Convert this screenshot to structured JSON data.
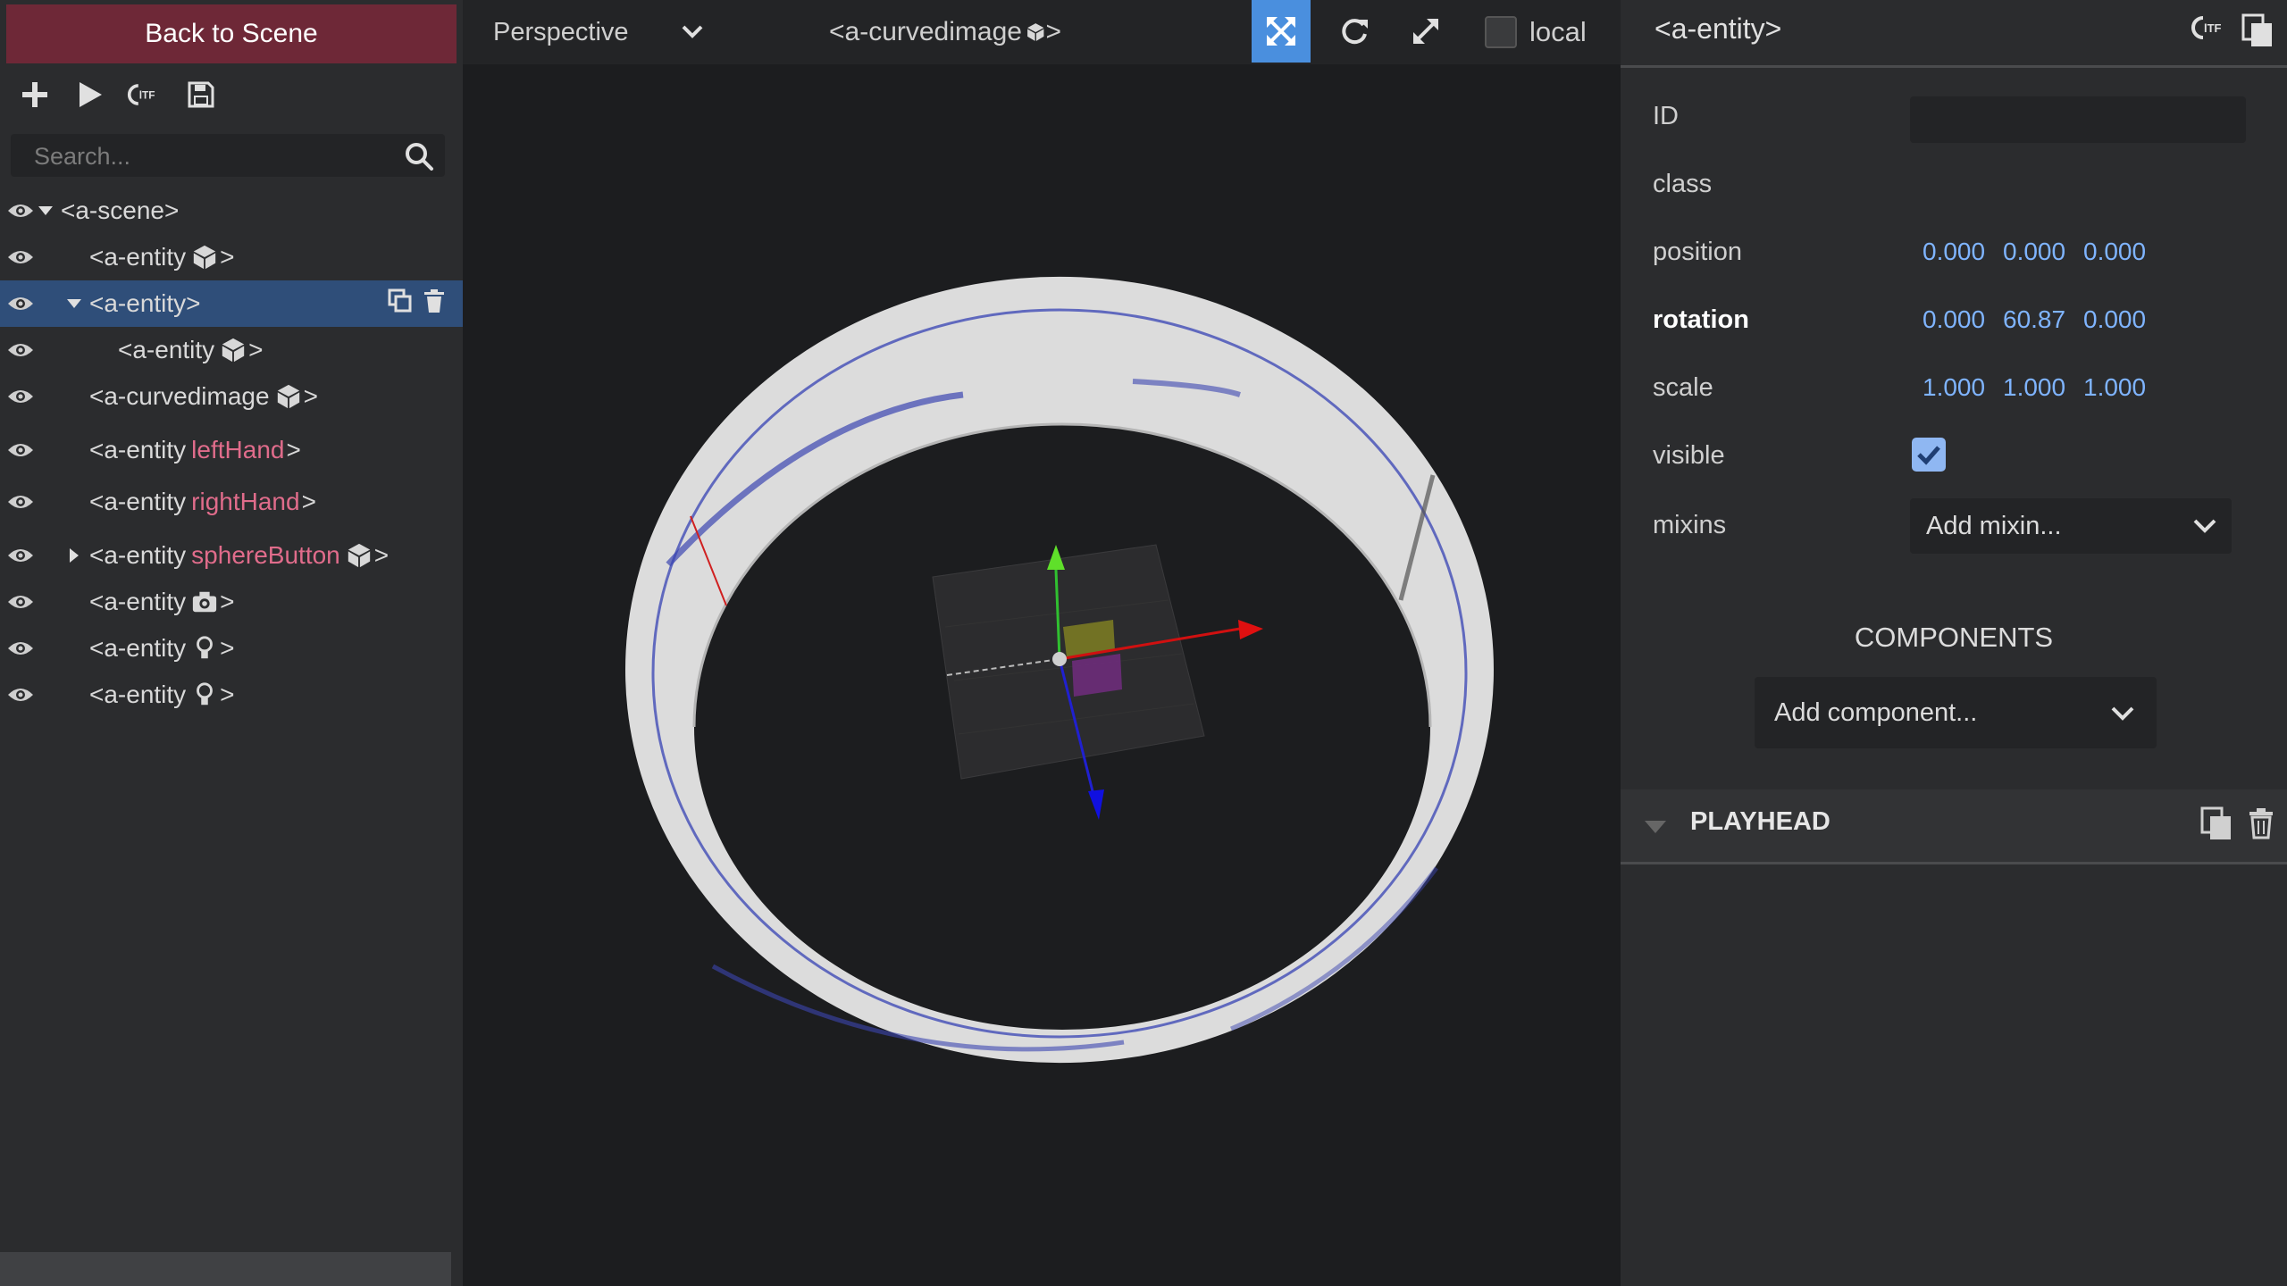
{
  "left": {
    "back_label": "Back to Scene",
    "search_placeholder": "Search...",
    "tree": [
      {
        "tag": "<a-scene>",
        "id": "",
        "suffix": ""
      },
      {
        "tag": "<a-entity",
        "id": "",
        "suffix": ">",
        "icon": "cube-icon"
      },
      {
        "tag": "<a-entity>",
        "id": "",
        "suffix": "",
        "selected": true
      },
      {
        "tag": "<a-entity",
        "id": "",
        "suffix": ">",
        "icon": "cube-icon"
      },
      {
        "tag": "<a-curvedimage",
        "id": "",
        "suffix": ">",
        "icon": "cube-icon"
      },
      {
        "tag": "<a-entity",
        "id": "leftHand",
        "suffix": ">"
      },
      {
        "tag": "<a-entity",
        "id": "rightHand",
        "suffix": ">"
      },
      {
        "tag": "<a-entity",
        "id": "sphereButton",
        "suffix": ">",
        "icon": "cube-icon"
      },
      {
        "tag": "<a-entity",
        "id": "",
        "suffix": ">",
        "icon": "camera-icon"
      },
      {
        "tag": "<a-entity",
        "id": "",
        "suffix": ">",
        "icon": "light-bulb-icon"
      },
      {
        "tag": "<a-entity",
        "id": "",
        "suffix": ">",
        "icon": "light-bulb-icon"
      }
    ]
  },
  "viewport": {
    "camera": "Perspective",
    "entity_title": "<a-curvedimage",
    "entity_title_suffix": ">",
    "local_label": "local",
    "accent": "#4a8fde"
  },
  "right": {
    "title": "<a-entity>",
    "props": {
      "id_label": "ID",
      "class_label": "class",
      "position_label": "position",
      "position": [
        "0.000",
        "0.000",
        "0.000"
      ],
      "rotation_label": "rotation",
      "rotation": [
        "0.000",
        "60.87",
        "0.000"
      ],
      "scale_label": "scale",
      "scale": [
        "1.000",
        "1.000",
        "1.000"
      ],
      "visible_label": "visible",
      "visible": true,
      "mixins_label": "mixins",
      "mixins_placeholder": "Add mixin..."
    },
    "components_heading": "COMPONENTS",
    "add_component": "Add component...",
    "playhead_title": "PLAYHEAD"
  },
  "colors": {
    "back_button": "#6e2837",
    "selected_row": "#2f4e79",
    "value_blue": "#7fb4ff",
    "id_pink": "#e06c8b"
  }
}
